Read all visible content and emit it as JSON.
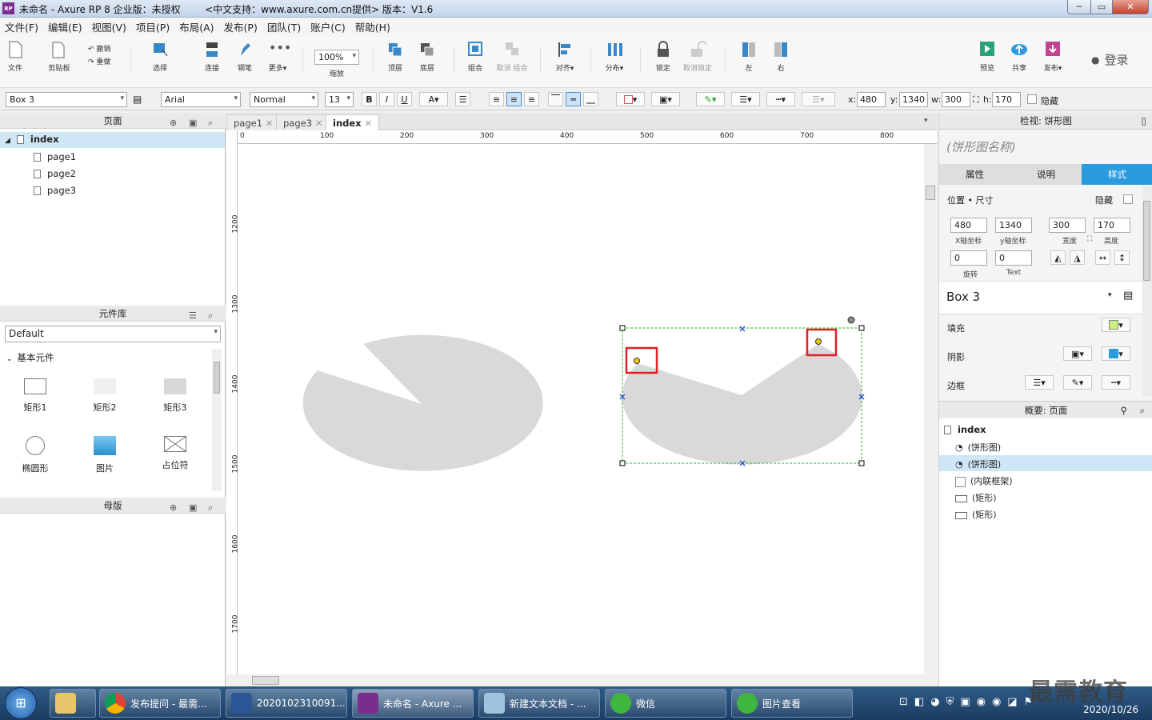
{
  "window": {
    "title": "未命名 - Axure RP 8 企业版：未授权        <中文支持：www.axurе.com.cn提供> 版本：V1.6",
    "rp_badge": "RP",
    "min": "─",
    "max": "▭",
    "close": "✕"
  },
  "menu": [
    "文件(F)",
    "编辑(E)",
    "视图(V)",
    "项目(P)",
    "布局(A)",
    "发布(P)",
    "团队(T)",
    "账户(C)",
    "帮助(H)"
  ],
  "toolbar": {
    "file": "文件",
    "clipboard": "剪贴板",
    "undo": "撤销",
    "redo": "重做",
    "select": "选择",
    "connect": "连接",
    "pen": "钢笔",
    "more": "更多▾",
    "zoom": "100%",
    "zoom_label": "缩放",
    "top": "顶层",
    "bottom": "底层",
    "group": "组合",
    "ungroup": "取消 组合",
    "align": "对齐▾",
    "distribute": "分布▾",
    "lock": "锁定",
    "unlock": "取消锁定",
    "left": "左",
    "right": "右",
    "preview": "预览",
    "share": "共享",
    "publish": "发布▾",
    "login": "登录"
  },
  "format": {
    "widget": "Box 3",
    "font": "Arial",
    "style": "Normal",
    "size": "13",
    "bold": "B",
    "italic": "I",
    "underline": "U",
    "x_label": "x:",
    "x": "480",
    "y_label": "y:",
    "y": "1340",
    "w_label": "w:",
    "w": "300",
    "h_label": "h:",
    "h": "170",
    "hidden": "隐藏"
  },
  "pages": {
    "title": "页面",
    "root": "index",
    "children": [
      "page1",
      "page2",
      "page3"
    ]
  },
  "library": {
    "title": "元件库",
    "selected": "Default",
    "section": "基本元件",
    "items": [
      "矩形1",
      "矩形2",
      "矩形3",
      "椭圆形",
      "图片",
      "占位符"
    ]
  },
  "masters": {
    "title": "母版"
  },
  "tabs": [
    "page1",
    "page3",
    "index"
  ],
  "ruler": {
    "h": [
      "0",
      "100",
      "200",
      "300",
      "400",
      "500",
      "600",
      "700",
      "800"
    ],
    "v": [
      "1200",
      "1300",
      "1400",
      "1500",
      "1600",
      "1700"
    ]
  },
  "inspector": {
    "title": "检视: 饼形图",
    "name_placeholder": "(饼形图名称)",
    "tabs": [
      "属性",
      "说明",
      "样式"
    ],
    "section": "位置 • 尺寸",
    "hidden": "隐藏",
    "x": "480",
    "y": "1340",
    "w": "300",
    "h": "170",
    "x_label": "X轴坐标",
    "y_label": "y轴坐标",
    "w_label": "宽度",
    "h_label": "高度",
    "rot": "0",
    "text_rot": "0",
    "rot_label": "旋转",
    "text_label": "Text",
    "style_name": "Box 3",
    "fill": "填充",
    "shadow": "阴影",
    "border": "边框"
  },
  "outline": {
    "title": "概要: 页面",
    "root": "index",
    "items": [
      "(饼形图)",
      "(饼形图)",
      "(内联框架)",
      "(矩形)",
      "(矩形)"
    ]
  },
  "taskbar": {
    "items": [
      "发布提问 - 最需...",
      "2020102310091...",
      "未命名 - Axure ...",
      "新建文本文档 - ...",
      "微信",
      "图片查看"
    ],
    "date": "2020/10/26",
    "watermark": "最需教育"
  },
  "colors": {
    "accent": "#2b9be0",
    "pie": "#d9d9d9",
    "handle": "#f5c400",
    "highlight": "#e02020"
  }
}
